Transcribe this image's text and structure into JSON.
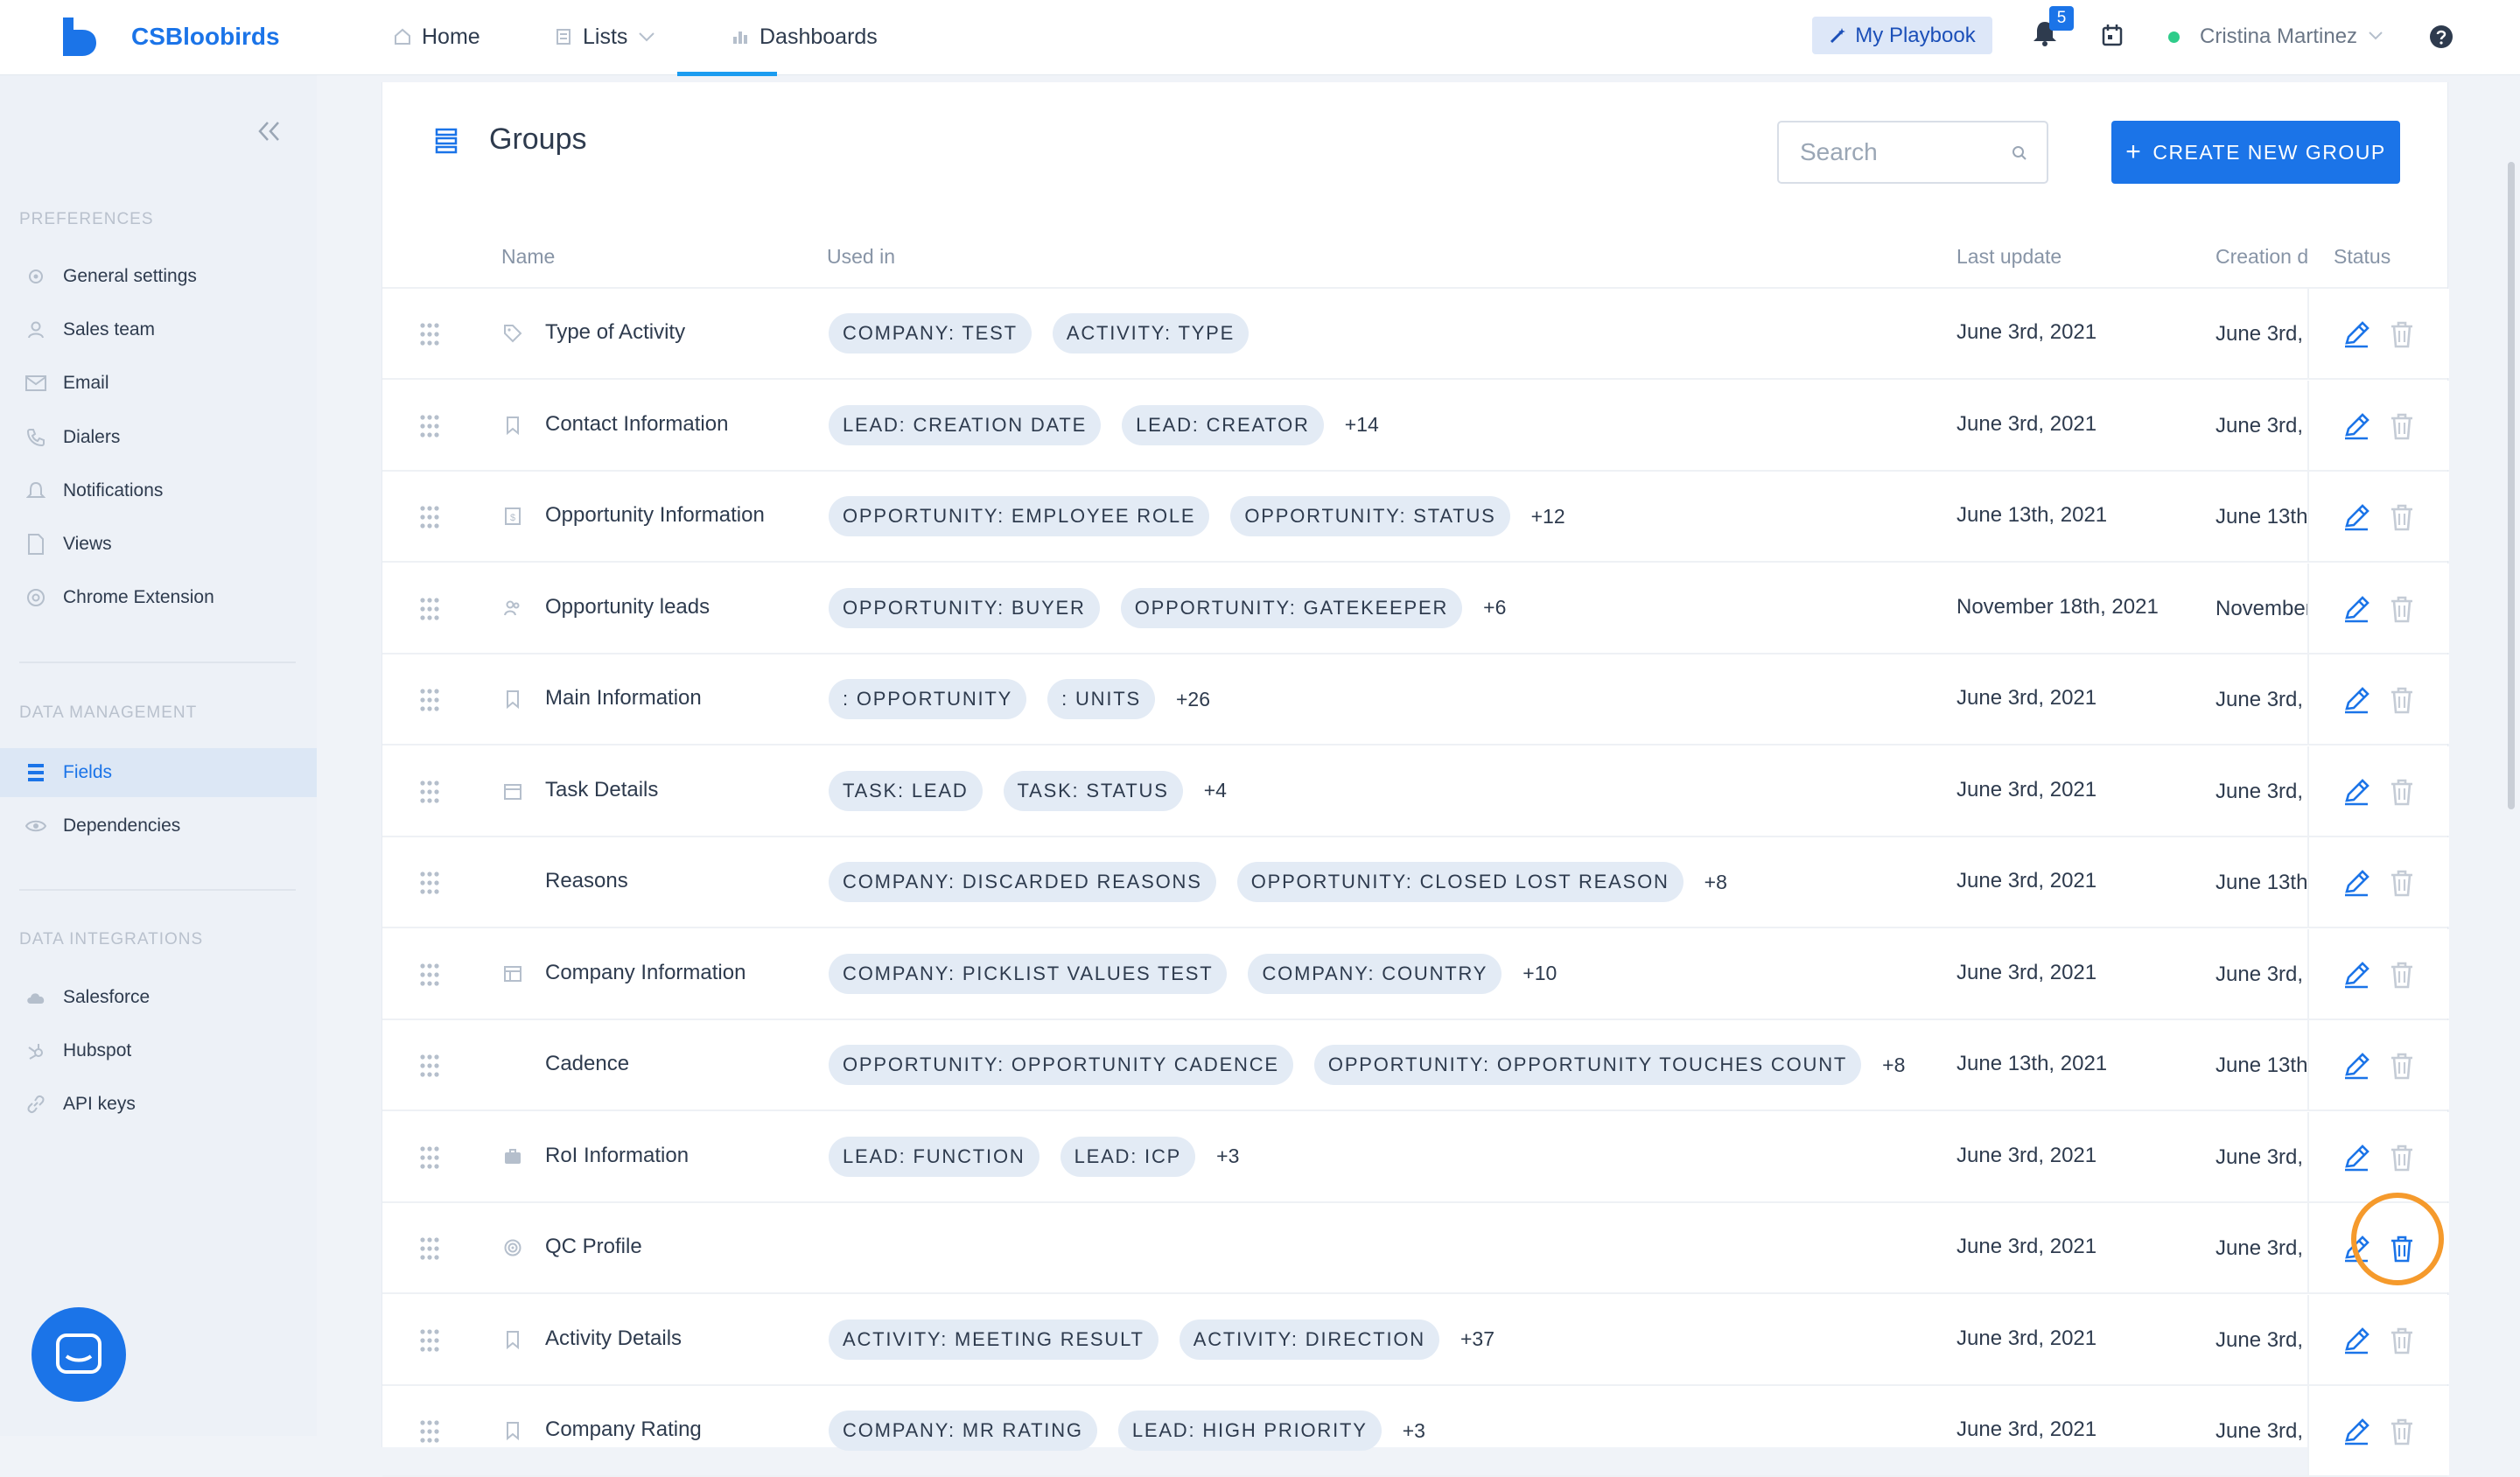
{
  "app": {
    "brand": "CSBloobirds",
    "nav": {
      "home": "Home",
      "lists": "Lists",
      "dashboards": "Dashboards"
    },
    "playbook_label": "My Playbook",
    "notification_count": "5",
    "user_name": "Cristina Martinez",
    "colors": {
      "accent": "#1b74e8",
      "highlight": "#f59a2c",
      "online": "#2ecc8a"
    }
  },
  "sidebar": {
    "preferences_title": "PREFERENCES",
    "preferences": [
      {
        "label": "General settings",
        "icon": "gear-icon"
      },
      {
        "label": "Sales team",
        "icon": "user-icon"
      },
      {
        "label": "Email",
        "icon": "mail-icon"
      },
      {
        "label": "Dialers",
        "icon": "phone-icon"
      },
      {
        "label": "Notifications",
        "icon": "bell-icon"
      },
      {
        "label": "Views",
        "icon": "document-icon"
      },
      {
        "label": "Chrome Extension",
        "icon": "chrome-icon"
      }
    ],
    "data_management_title": "DATA MANAGEMENT",
    "data_management": [
      {
        "label": "Fields",
        "icon": "list-icon",
        "active": true
      },
      {
        "label": "Dependencies",
        "icon": "eye-icon"
      }
    ],
    "data_integrations_title": "DATA INTEGRATIONS",
    "data_integrations": [
      {
        "label": "Salesforce",
        "icon": "cloud-icon"
      },
      {
        "label": "Hubspot",
        "icon": "hubspot-icon"
      },
      {
        "label": "API keys",
        "icon": "link-icon"
      }
    ]
  },
  "main": {
    "title": "Groups",
    "search_placeholder": "Search",
    "create_button": "CREATE NEW GROUP",
    "columns": {
      "name": "Name",
      "used_in": "Used in",
      "last_update": "Last update",
      "creation": "Creation d",
      "status": "Status"
    },
    "rows": [
      {
        "name": "Type of Activity",
        "icon": "tag-icon",
        "tags": [
          "COMPANY: TEST",
          "ACTIVITY: TYPE"
        ],
        "more": "",
        "last_update": "June 3rd, 2021",
        "creation": "June 3rd,"
      },
      {
        "name": "Contact Information",
        "icon": "bookmark-icon",
        "tags": [
          "LEAD: CREATION DATE",
          "LEAD: CREATOR"
        ],
        "more": "+14",
        "last_update": "June 3rd, 2021",
        "creation": "June 3rd,"
      },
      {
        "name": "Opportunity Information",
        "icon": "opportunity-icon",
        "tags": [
          "OPPORTUNITY: EMPLOYEE ROLE",
          "OPPORTUNITY: STATUS"
        ],
        "more": "+12",
        "last_update": "June 13th, 2021",
        "creation": "June 13th,"
      },
      {
        "name": "Opportunity leads",
        "icon": "people-icon",
        "tags": [
          "OPPORTUNITY: BUYER",
          "OPPORTUNITY: GATEKEEPER"
        ],
        "more": "+6",
        "last_update": "November 18th, 2021",
        "creation": "November"
      },
      {
        "name": "Main Information",
        "icon": "bookmark-icon",
        "tags": [
          ": OPPORTUNITY",
          ": UNITS"
        ],
        "more": "+26",
        "last_update": "June 3rd, 2021",
        "creation": "June 3rd,"
      },
      {
        "name": "Task Details",
        "icon": "calendar-icon",
        "tags": [
          "TASK: LEAD",
          "TASK: STATUS"
        ],
        "more": "+4",
        "last_update": "June 3rd, 2021",
        "creation": "June 3rd,"
      },
      {
        "name": "Reasons",
        "icon": "",
        "tags": [
          "COMPANY: DISCARDED REASONS",
          "OPPORTUNITY: CLOSED LOST REASON"
        ],
        "more": "+8",
        "last_update": "June 3rd, 2021",
        "creation": "June 13th,"
      },
      {
        "name": "Company Information",
        "icon": "company-icon",
        "tags": [
          "COMPANY: PICKLIST VALUES TEST",
          "COMPANY: COUNTRY"
        ],
        "more": "+10",
        "last_update": "June 3rd, 2021",
        "creation": "June 3rd,"
      },
      {
        "name": "Cadence",
        "icon": "",
        "tags": [
          "OPPORTUNITY: OPPORTUNITY CADENCE",
          "OPPORTUNITY: OPPORTUNITY TOUCHES COUNT"
        ],
        "more": "+8",
        "last_update": "June 13th, 2021",
        "creation": "June 13th,"
      },
      {
        "name": "RoI Information",
        "icon": "briefcase-icon",
        "tags": [
          "LEAD: FUNCTION",
          "LEAD: ICP"
        ],
        "more": "+3",
        "last_update": "June 3rd, 2021",
        "creation": "June 3rd,"
      },
      {
        "name": "QC Profile",
        "icon": "target-icon",
        "tags": [],
        "more": "",
        "last_update": "June 3rd, 2021",
        "creation": "June 3rd,"
      },
      {
        "name": "Activity Details",
        "icon": "bookmark-icon",
        "tags": [
          "ACTIVITY: MEETING RESULT",
          "ACTIVITY: DIRECTION"
        ],
        "more": "+37",
        "last_update": "June 3rd, 2021",
        "creation": "June 3rd,"
      },
      {
        "name": "Company Rating",
        "icon": "bookmark-icon",
        "tags": [
          "COMPANY: MR RATING",
          "LEAD: HIGH PRIORITY"
        ],
        "more": "+3",
        "last_update": "June 3rd, 2021",
        "creation": "June 3rd,"
      }
    ]
  }
}
